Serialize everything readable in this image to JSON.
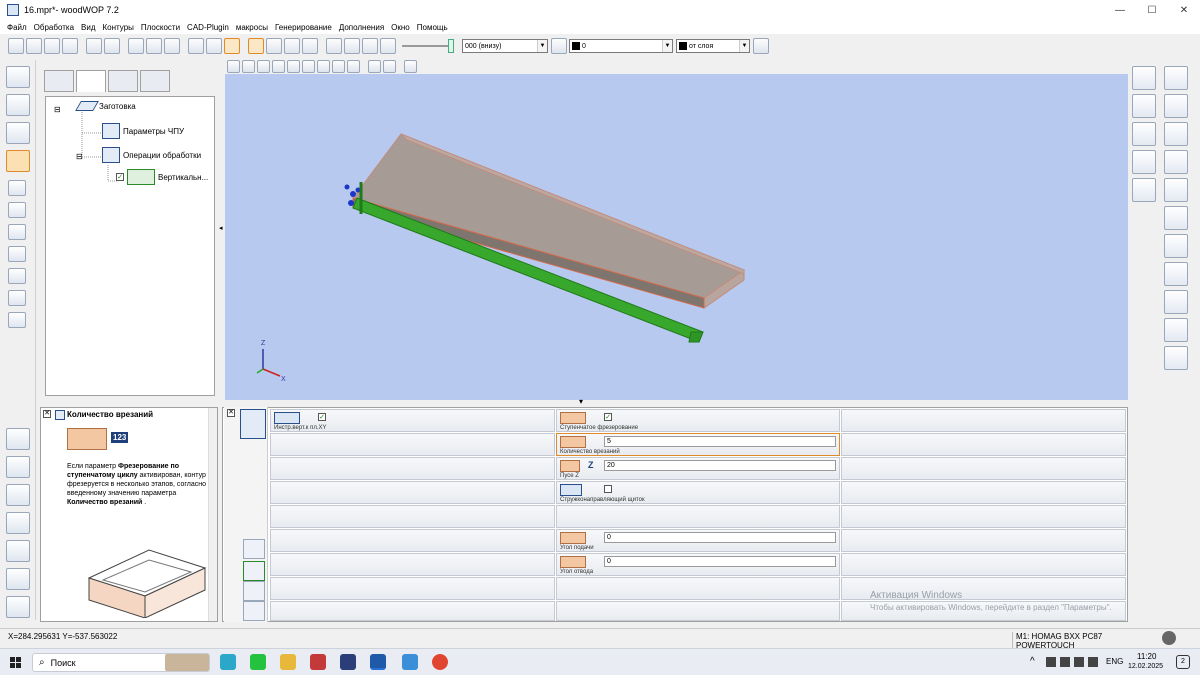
{
  "window": {
    "title": "16.mpr*- woodWOP 7.2",
    "minimize": "—",
    "maximize": "☐",
    "close": "✕"
  },
  "menu": [
    "Файл",
    "Обработка",
    "Вид",
    "Контуры",
    "Плоскости",
    "CAD-Plugin",
    "макросы",
    "Генерирование",
    "Дополнения",
    "Окно",
    "Помощь"
  ],
  "toolbar": {
    "plane_combo": "000 (внизу)",
    "color_combo": "0",
    "layer_combo": "от слоя",
    "combo_arrow": "▼"
  },
  "tree": {
    "root": "Заготовка",
    "cnc_params": "Параметры ЧПУ",
    "operations": "Операции обработки",
    "vertical_item": "Вертикальн...",
    "expand_minus": "⊟",
    "checkmark": "✓"
  },
  "viewport": {
    "axis_x": "X",
    "axis_z": "Z",
    "splitter_arrow": "▾",
    "side_arrow": "◂"
  },
  "help": {
    "title": "Количество врезаний",
    "icon_number": "123",
    "text_prefix": "Если параметр ",
    "text_bold1": "Фрезерование по ступенчатому циклу",
    "text_mid": " активирован, контур фрезеруется в несколько этапов, согласно введенному значению параметра ",
    "text_bold2": "Количество врезаний",
    "text_suffix": " ."
  },
  "params": {
    "col1": {
      "instr_label": "Инстр.верт.к пл.XY",
      "instr_checked": "✓"
    },
    "col2": {
      "step_label": "Ступенчатое фрезерование",
      "step_checked": "✓",
      "count_label": "Количество врезаний",
      "count_value": "5",
      "empty_z_label": "Пусе Z",
      "empty_z_letter": "Z",
      "empty_z_value": "20",
      "shield_label": "Стружконаправляющий щиток",
      "shield_checked": "",
      "feed_angle_label": "Угол подачи",
      "feed_angle_value": "0",
      "retract_angle_label": "Угол отвода",
      "retract_angle_value": "0"
    }
  },
  "status": {
    "coords": "X=284.295631 Y=-537.563022",
    "machine": "M1: HOMAG BXX PC87 POWERTOUCH"
  },
  "watermark": {
    "line1": "Активация Windows",
    "line2": "Чтобы активировать Windows, перейдите в раздел \"Параметры\"."
  },
  "taskbar": {
    "search": "Поиск",
    "lang": "ENG",
    "time": "11:20",
    "date": "12.02.2025",
    "notify_count": "2",
    "tray_chevron": "^"
  },
  "colors": {
    "viewport_bg": "#b8c9ef",
    "panel_top": "#a89e98",
    "panel_front": "#8c817a",
    "milling_green": "#33a82a",
    "accent_orange": "#e08a2a"
  }
}
